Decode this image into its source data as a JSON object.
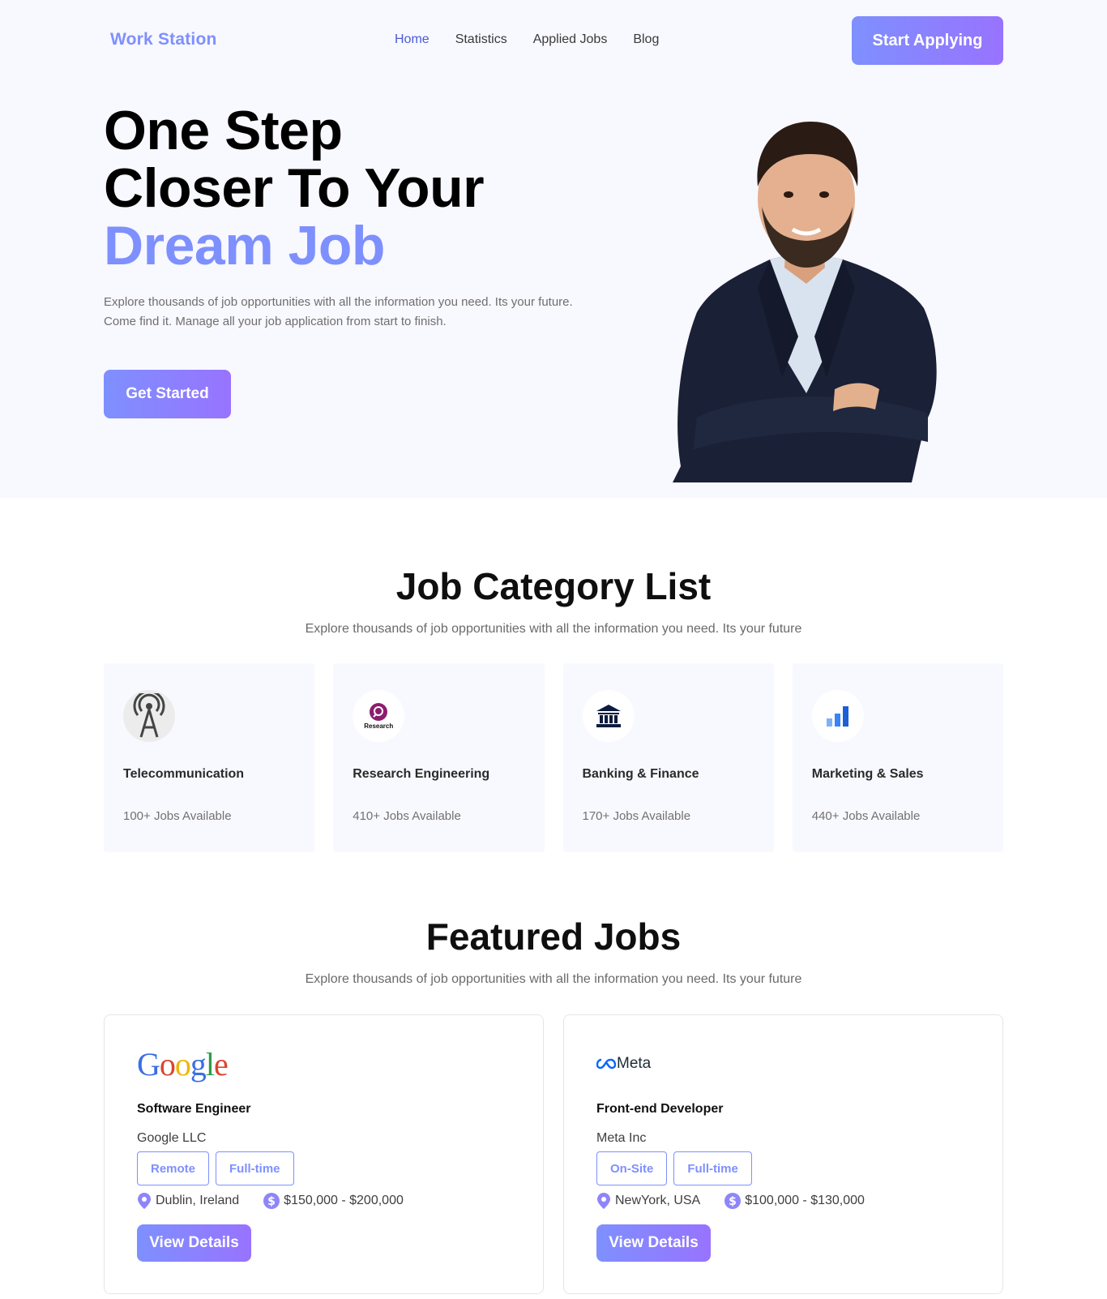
{
  "nav": {
    "brand": "Work Station",
    "links": [
      {
        "label": "Home",
        "active": true
      },
      {
        "label": "Statistics"
      },
      {
        "label": "Applied Jobs"
      },
      {
        "label": "Blog"
      }
    ],
    "cta": "Start Applying"
  },
  "hero": {
    "title_line1": "One Step",
    "title_line2": "Closer To Your",
    "title_accent": "Dream Job",
    "description": "Explore thousands of job opportunities with all the information you need. Its your future. Come find it. Manage all your job application from start to finish.",
    "cta": "Get Started"
  },
  "categories": {
    "title": "Job Category List",
    "subtitle": "Explore thousands of job opportunities with all the information you need. Its your future",
    "items": [
      {
        "name": "Telecommunication",
        "count": "100+ Jobs Available",
        "icon": "antenna-icon"
      },
      {
        "name": "Research Engineering",
        "count": "410+ Jobs Available",
        "icon": "research-icon",
        "icon_text": "Research"
      },
      {
        "name": "Banking & Finance",
        "count": "170+ Jobs Available",
        "icon": "bank-icon"
      },
      {
        "name": "Marketing & Sales",
        "count": "440+ Jobs Available",
        "icon": "bar-chart-icon"
      }
    ]
  },
  "featured": {
    "title": "Featured Jobs",
    "subtitle": "Explore thousands of job opportunities with all the information you need. Its your future",
    "jobs": [
      {
        "logo": "Google",
        "title": "Software Engineer",
        "company": "Google LLC",
        "tags": [
          "Remote",
          "Full-time"
        ],
        "location": "Dublin, Ireland",
        "salary": "$150,000 - $200,000",
        "cta": "View Details"
      },
      {
        "logo": "Meta",
        "title": "Front-end Developer",
        "company": "Meta Inc",
        "tags": [
          "On-Site",
          "Full-time"
        ],
        "location": "NewYork, USA",
        "salary": "$100,000 - $130,000",
        "cta": "View Details"
      }
    ]
  },
  "colors": {
    "accent": "#7e90fe",
    "accent_end": "#9873ff",
    "hero_bg": "#f8f8ff"
  }
}
